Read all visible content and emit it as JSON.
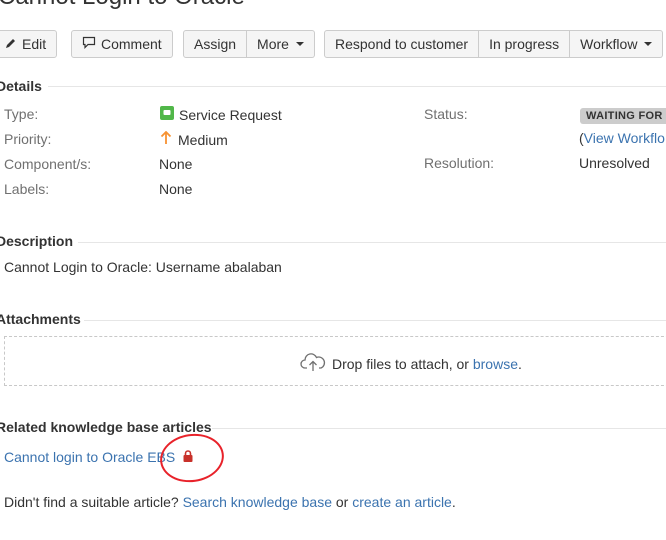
{
  "issue": {
    "title": "Cannot Login to Oracle"
  },
  "toolbar": {
    "edit_label": "Edit",
    "comment_label": "Comment",
    "assign_label": "Assign",
    "more_label": "More",
    "respond_label": "Respond to customer",
    "in_progress_label": "In progress",
    "workflow_label": "Workflow"
  },
  "details": {
    "heading": "Details",
    "type_label": "Type:",
    "type_value": "Service Request",
    "priority_label": "Priority:",
    "priority_value": "Medium",
    "components_label": "Component/s:",
    "components_value": "None",
    "labels_label": "Labels:",
    "labels_value": "None",
    "status_label": "Status:",
    "status_value": "WAITING FOR S",
    "view_workflow_open": "(",
    "view_workflow_link": "View Workflo",
    "resolution_label": "Resolution:",
    "resolution_value": "Unresolved"
  },
  "description": {
    "heading": "Description",
    "text": "Cannot Login to Oracle: Username abalaban"
  },
  "attachments": {
    "heading": "Attachments",
    "drop_text": "Drop files to attach, or ",
    "browse_link": "browse",
    "browse_suffix": "."
  },
  "kb": {
    "heading": "Related knowledge base articles",
    "article_link": "Cannot login to Oracle EBS",
    "footer_prefix": "Didn't find a suitable article? ",
    "search_link": "Search knowledge base",
    "footer_or": " or ",
    "create_link": "create an article",
    "footer_suffix": "."
  },
  "colors": {
    "link": "#3b73af",
    "priority_arrow": "#f79232",
    "type_icon": "#51b749",
    "lock_icon": "#c8312a",
    "annotation": "#e8222a"
  }
}
